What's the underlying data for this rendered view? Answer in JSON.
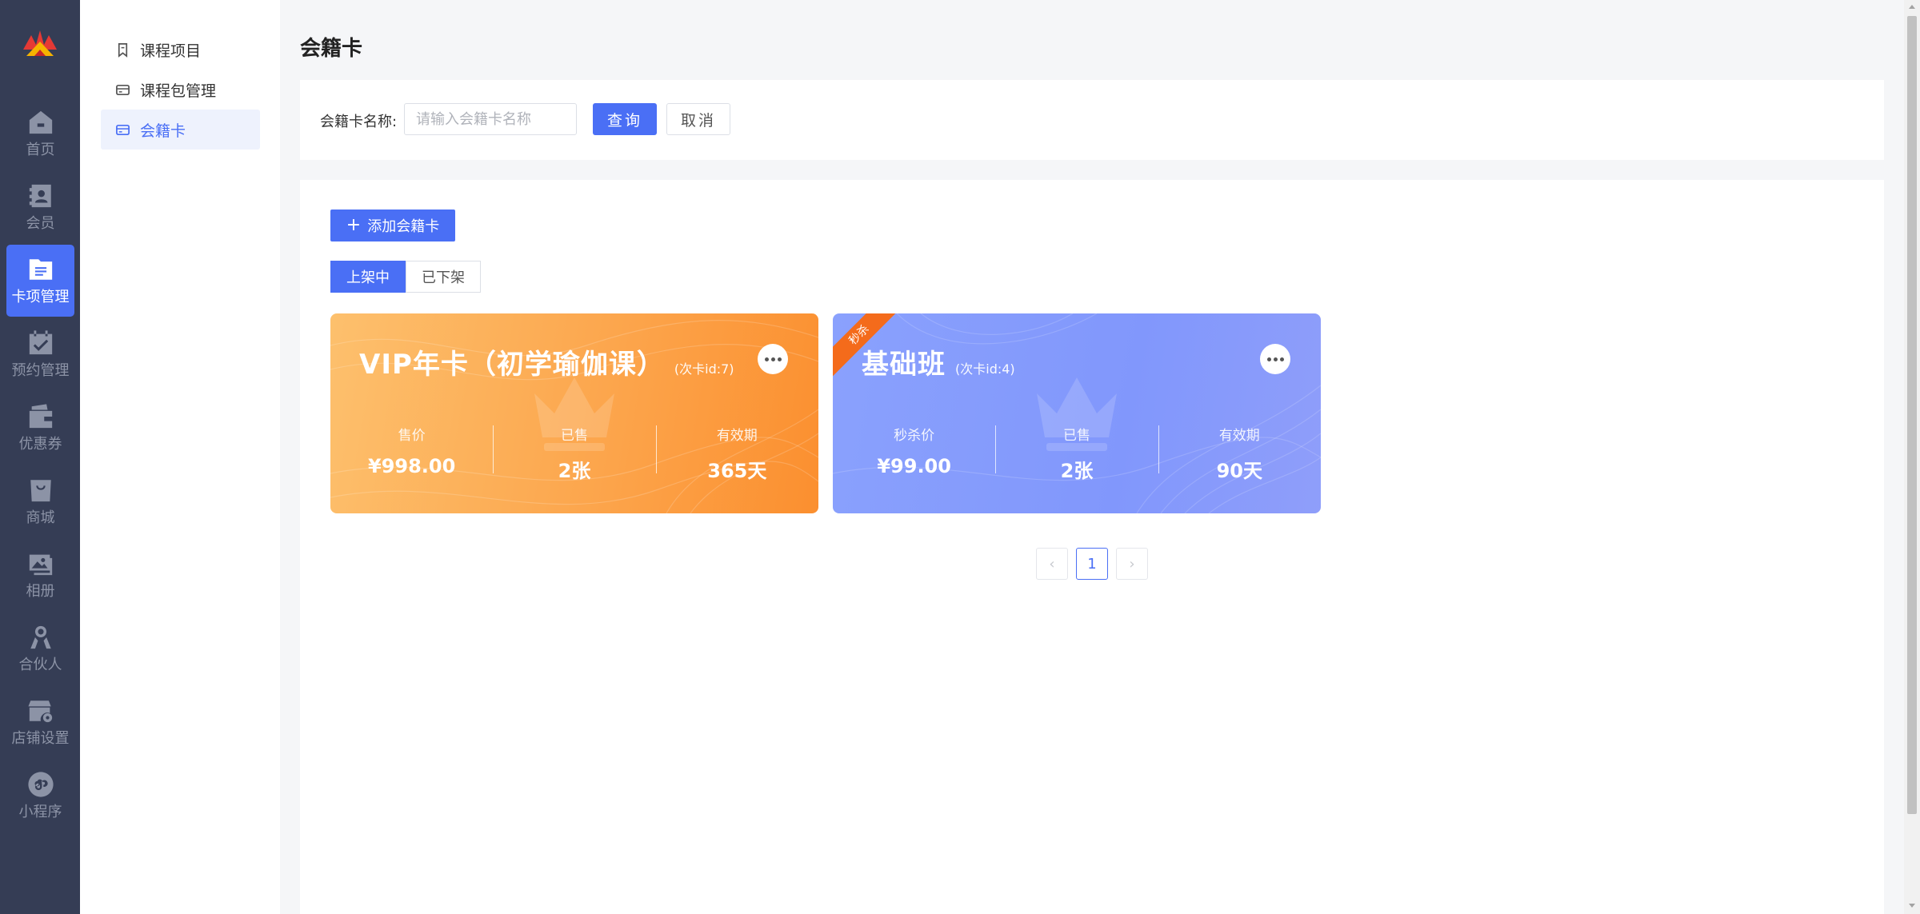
{
  "rail": {
    "items": [
      {
        "label": "首页",
        "icon": "home-icon"
      },
      {
        "label": "会员",
        "icon": "member-icon"
      },
      {
        "label": "卡项管理",
        "icon": "card-manage-icon"
      },
      {
        "label": "预约管理",
        "icon": "calendar-icon"
      },
      {
        "label": "优惠券",
        "icon": "wallet-icon"
      },
      {
        "label": "商城",
        "icon": "shop-bag-icon"
      },
      {
        "label": "相册",
        "icon": "album-icon"
      },
      {
        "label": "合伙人",
        "icon": "partner-icon"
      },
      {
        "label": "店铺设置",
        "icon": "store-settings-icon"
      },
      {
        "label": "小程序",
        "icon": "mini-program-icon"
      }
    ],
    "active_index": 2
  },
  "submenu": {
    "items": [
      {
        "label": "课程项目",
        "icon": "bookmark-icon"
      },
      {
        "label": "课程包管理",
        "icon": "card-icon"
      },
      {
        "label": "会籍卡",
        "icon": "card-icon"
      }
    ],
    "active_index": 2
  },
  "page": {
    "title": "会籍卡"
  },
  "filter": {
    "label": "会籍卡名称:",
    "placeholder": "请输入会籍卡名称",
    "value": "",
    "query_label": "查询",
    "cancel_label": "取消"
  },
  "toolbar": {
    "add_label": "添加会籍卡"
  },
  "tabs": [
    {
      "label": "上架中",
      "active": true
    },
    {
      "label": "已下架",
      "active": false
    }
  ],
  "cards": [
    {
      "name": "VIP年卡（初学瑜伽课）",
      "id_text": "(次卡id:7)",
      "theme": "orange",
      "ribbon": "",
      "stats": [
        {
          "label": "售价",
          "value": "¥998.00"
        },
        {
          "label": "已售",
          "value": "2张"
        },
        {
          "label": "有效期",
          "value": "365天"
        }
      ]
    },
    {
      "name": "基础班",
      "id_text": "(次卡id:4)",
      "theme": "blue",
      "ribbon": "秒杀",
      "stats": [
        {
          "label": "秒杀价",
          "value": "¥99.00"
        },
        {
          "label": "已售",
          "value": "2张"
        },
        {
          "label": "有效期",
          "value": "90天"
        }
      ]
    }
  ],
  "pagination": {
    "current": "1",
    "prev": "‹",
    "next": "›"
  },
  "colors": {
    "primary": "#4a6ff5",
    "rail_bg": "#353d55",
    "card_orange": "#fca64d",
    "card_blue": "#8197fc",
    "ribbon": "#f46b1b"
  }
}
